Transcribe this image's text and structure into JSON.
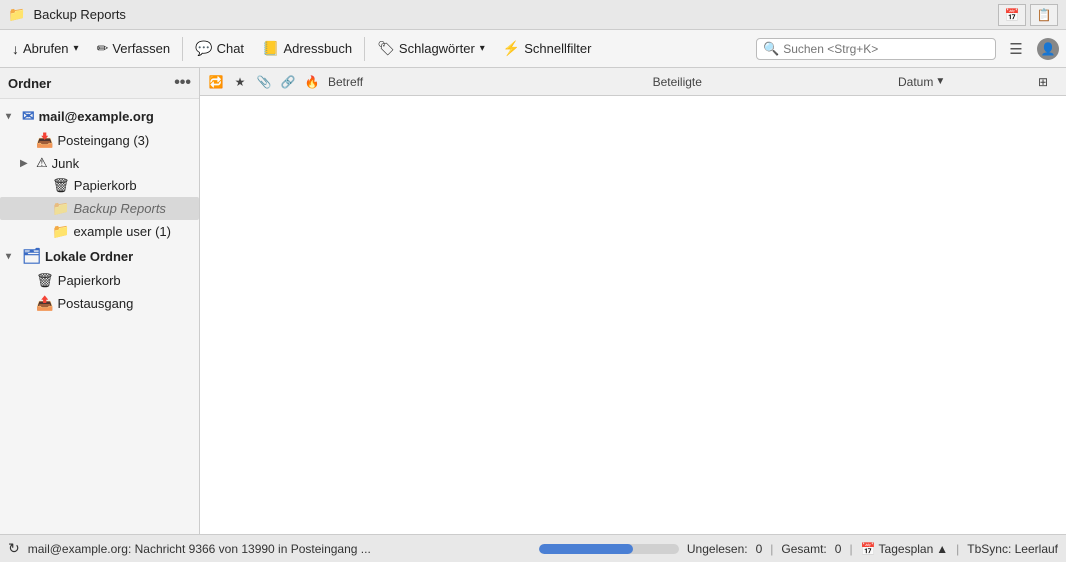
{
  "titlebar": {
    "title": "Backup Reports",
    "icon": "📁",
    "btn1_icon": "📅",
    "btn2_icon": "📋"
  },
  "toolbar": {
    "abrufen_label": "Abrufen",
    "abrufen_icon": "↓",
    "verfassen_label": "Verfassen",
    "verfassen_icon": "✏",
    "chat_label": "Chat",
    "chat_icon": "💬",
    "adressbuch_label": "Adressbuch",
    "adressbuch_icon": "📒",
    "schlagwoerter_label": "Schlagwörter",
    "schlagwoerter_icon": "🏷",
    "schnellfilter_label": "Schnellfilter",
    "schnellfilter_icon": "⚡",
    "search_placeholder": "Suchen <Strg+K>",
    "menu_icon": "☰",
    "profile_icon": "👤"
  },
  "sidebar": {
    "header": "Ordner",
    "more_icon": "•••",
    "accounts": [
      {
        "name": "mail@example.org",
        "icon": "✉",
        "color": "#3a6bc4",
        "expanded": true,
        "folders": [
          {
            "name": "Posteingang (3)",
            "icon": "📥",
            "indent": 1,
            "selected": false,
            "type": "inbox"
          },
          {
            "name": "Junk",
            "icon": "⚠",
            "indent": 1,
            "expanded": false,
            "has_expand": true,
            "type": "junk"
          },
          {
            "name": "Papierkorb",
            "icon": "🗑",
            "indent": 2,
            "type": "trash"
          },
          {
            "name": "Backup Reports",
            "icon": "📁",
            "indent": 2,
            "selected": true,
            "type": "folder",
            "dimmed": true
          },
          {
            "name": "example user (1)",
            "icon": "📁",
            "indent": 2,
            "type": "folder"
          }
        ]
      },
      {
        "name": "Lokale Ordner",
        "icon": "🗂",
        "color": "#3a6bc4",
        "expanded": true,
        "folders": [
          {
            "name": "Papierkorb",
            "icon": "🗑",
            "indent": 1,
            "type": "trash"
          },
          {
            "name": "Postausgang",
            "icon": "📤",
            "indent": 1,
            "type": "outbox"
          }
        ]
      }
    ]
  },
  "message_list": {
    "col_thread": "",
    "col_star": "★",
    "col_attachment": "📎",
    "col_thread_flag": "🔁",
    "col_prio": "🔥",
    "col_subject": "Betreff",
    "col_participants": "Beteiligte",
    "col_date": "Datum",
    "col_date_sort": "▼",
    "col_actions": ""
  },
  "statusbar": {
    "sync_icon": "↻",
    "message": "mail@example.org: Nachricht 9366 von 13990 in Posteingang ...",
    "progress_pct": 67,
    "unread_label": "Ungelesen:",
    "unread_count": "0",
    "total_label": "Gesamt:",
    "total_count": "0",
    "tagesplan_icon": "📅",
    "tagesplan_label": "Tagesplan",
    "tagesplan_arrow": "▲",
    "tbsync_label": "TbSync: Leerlauf"
  }
}
